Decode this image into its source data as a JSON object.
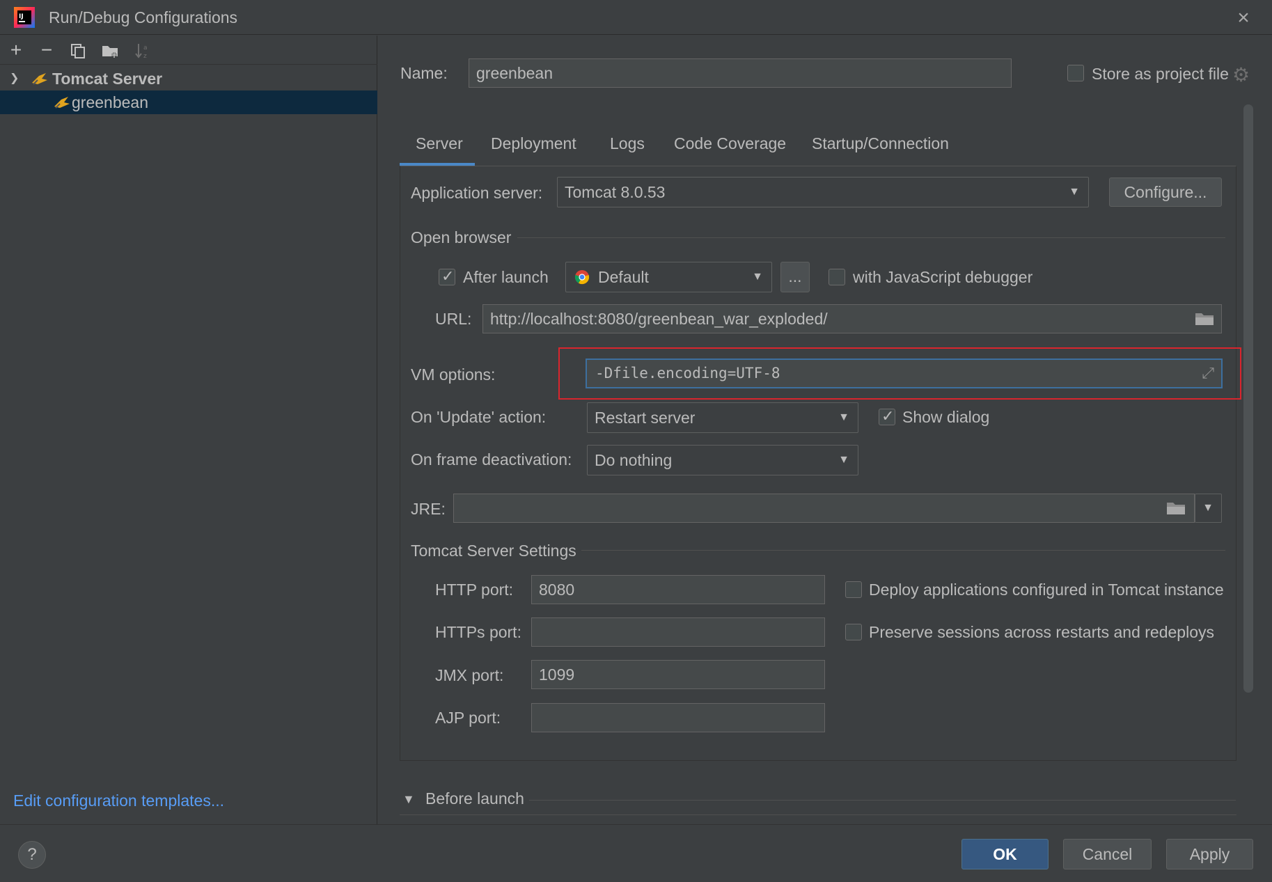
{
  "window": {
    "title": "Run/Debug Configurations"
  },
  "left": {
    "tree": {
      "group_label": "Tomcat Server",
      "item_label": "greenbean"
    },
    "edit_templates_link": "Edit configuration templates..."
  },
  "config": {
    "name_label": "Name:",
    "name_value": "greenbean",
    "store_label": "Store as project file",
    "store_checked": false
  },
  "tabs": [
    "Server",
    "Deployment",
    "Logs",
    "Code Coverage",
    "Startup/Connection"
  ],
  "server": {
    "app_server_label": "Application server:",
    "app_server_value": "Tomcat 8.0.53",
    "configure_button": "Configure...",
    "open_browser_label": "Open browser",
    "after_launch_label": "After launch",
    "after_launch_checked": true,
    "browser_value": "Default",
    "browse_button": "...",
    "js_debugger_label": "with JavaScript debugger",
    "js_debugger_checked": false,
    "url_label": "URL:",
    "url_value": "http://localhost:8080/greenbean_war_exploded/",
    "vm_label": "VM options:",
    "vm_value": "-Dfile.encoding=UTF-8",
    "update_label": "On 'Update' action:",
    "update_value": "Restart server",
    "show_dialog_label": "Show dialog",
    "show_dialog_checked": true,
    "frame_label": "On frame deactivation:",
    "frame_value": "Do nothing",
    "jre_label": "JRE:",
    "jre_value": "",
    "tomcat_settings_label": "Tomcat Server Settings",
    "http_port_label": "HTTP port:",
    "http_port_value": "8080",
    "https_port_label": "HTTPs port:",
    "https_port_value": "",
    "jmx_port_label": "JMX port:",
    "jmx_port_value": "1099",
    "ajp_port_label": "AJP port:",
    "ajp_port_value": "",
    "deploy_label": "Deploy applications configured in Tomcat instance",
    "deploy_checked": false,
    "preserve_label": "Preserve sessions across restarts and redeploys",
    "preserve_checked": false
  },
  "before_launch_label": "Before launch",
  "buttons": {
    "ok": "OK",
    "cancel": "Cancel",
    "apply": "Apply",
    "help": "?"
  },
  "colors": {
    "accent": "#4a88c7",
    "highlight_box": "#d9252d",
    "link": "#589df6",
    "primary_button": "#365880"
  }
}
